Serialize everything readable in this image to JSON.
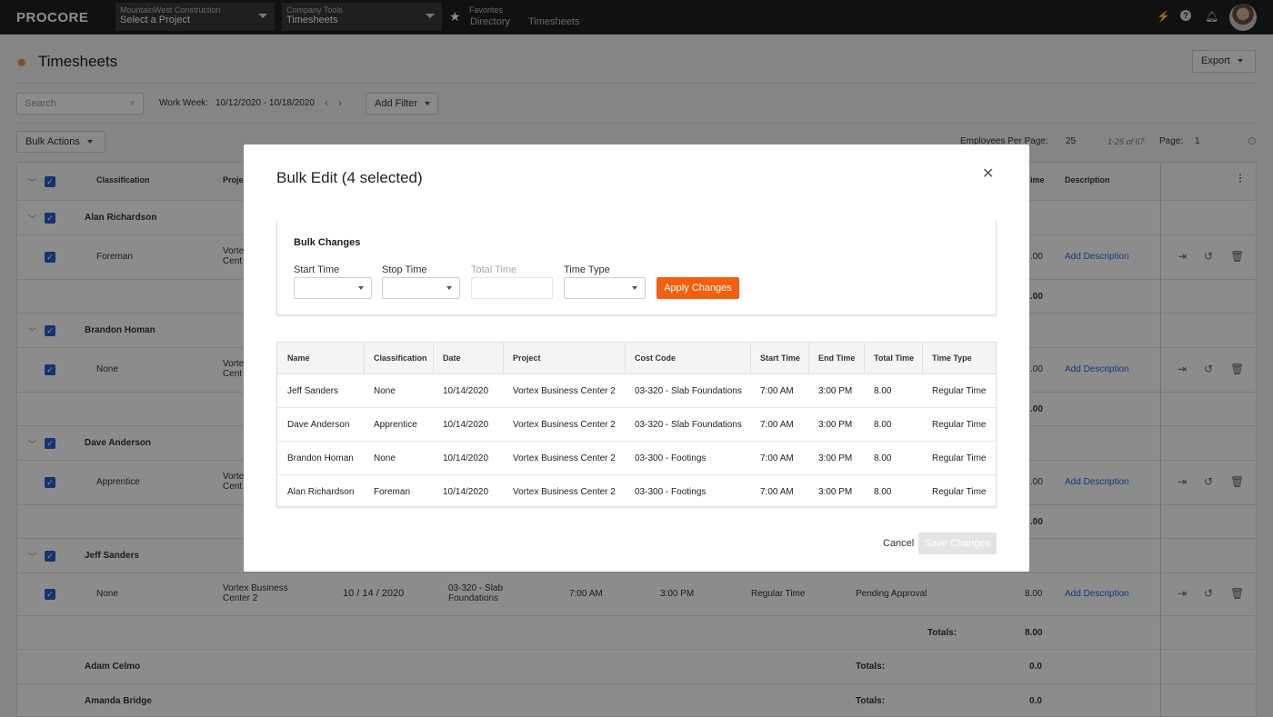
{
  "topbar": {
    "logo": "PROCORE",
    "project_picker": {
      "sub": "MountainWest Construction",
      "main": "Select a Project"
    },
    "tool_picker": {
      "sub": "Company Tools",
      "main": "Timesheets"
    },
    "favorites": {
      "sub": "Favorites",
      "links": [
        "Directory",
        "Timesheets"
      ]
    }
  },
  "page": {
    "title": "Timesheets",
    "export_label": "Export",
    "search_placeholder": "Search",
    "work_week_label": "Work Week:",
    "work_week_value": "10/12/2020 - 10/18/2020",
    "add_filter_label": "Add Filter",
    "bulk_actions_label": "Bulk Actions",
    "per_page_label": "Employees Per Page:",
    "per_page_value": "25",
    "range_text": "1-25 of 67",
    "page_label": "Page:",
    "page_value": "1"
  },
  "grid": {
    "headers": {
      "classification": "Classification",
      "project": "Projec",
      "time": "ime",
      "description": "Description"
    },
    "groups": [
      {
        "name": "Alan Richardson",
        "classification": "Foreman",
        "project": "Vorte\nCent",
        "total": ".00",
        "subtotal": ".00"
      },
      {
        "name": "Brandon Homan",
        "classification": "None",
        "project": "Vorte\nCent",
        "total": ".00",
        "subtotal": ".00"
      },
      {
        "name": "Dave Anderson",
        "classification": "Apprentice",
        "project": "Vorte\nCent",
        "total": ".00",
        "subtotal": ".00"
      }
    ],
    "jeff": {
      "name": "Jeff Sanders",
      "classification": "None",
      "project": "Vortex Business\nCenter 2",
      "date": "10 / 14 / 2020",
      "cost_code": "03-320 - Slab\nFoundations",
      "start": "7:00 AM",
      "end": "3:00 PM",
      "type": "Regular Time",
      "status": "Pending Approval",
      "total": "8.00",
      "totals_label": "Totals:",
      "totals_value": "8.00"
    },
    "add_description": "Add Description",
    "others": [
      {
        "name": "Adam Celmo",
        "totals_label": "Totals:",
        "totals_value": "0.0"
      },
      {
        "name": "Amanda Bridge",
        "totals_label": "Totals:",
        "totals_value": "0.0"
      }
    ]
  },
  "modal": {
    "title": "Bulk Edit (4 selected)",
    "panel_title": "Bulk Changes",
    "labels": {
      "start": "Start Time",
      "stop": "Stop Time",
      "total": "Total Time",
      "type": "Time Type"
    },
    "apply_label": "Apply Changes",
    "columns": [
      "Name",
      "Classification",
      "Date",
      "Project",
      "Cost Code",
      "Start Time",
      "End Time",
      "Total Time",
      "Time Type"
    ],
    "rows": [
      [
        "Jeff Sanders",
        "None",
        "10/14/2020",
        "Vortex Business Center 2",
        "03-320 - Slab Foundations",
        "7:00 AM",
        "3:00 PM",
        "8.00",
        "Regular Time"
      ],
      [
        "Dave Anderson",
        "Apprentice",
        "10/14/2020",
        "Vortex Business Center 2",
        "03-320 - Slab Foundations",
        "7:00 AM",
        "3:00 PM",
        "8.00",
        "Regular Time"
      ],
      [
        "Brandon Homan",
        "None",
        "10/14/2020",
        "Vortex Business Center 2",
        "03-300 - Footings",
        "7:00 AM",
        "3:00 PM",
        "8.00",
        "Regular Time"
      ],
      [
        "Alan Richardson",
        "Foreman",
        "10/14/2020",
        "Vortex Business Center 2",
        "03-300 - Footings",
        "7:00 AM",
        "3:00 PM",
        "8.00",
        "Regular Time"
      ]
    ],
    "cancel_label": "Cancel",
    "save_label": "Save Changes"
  }
}
